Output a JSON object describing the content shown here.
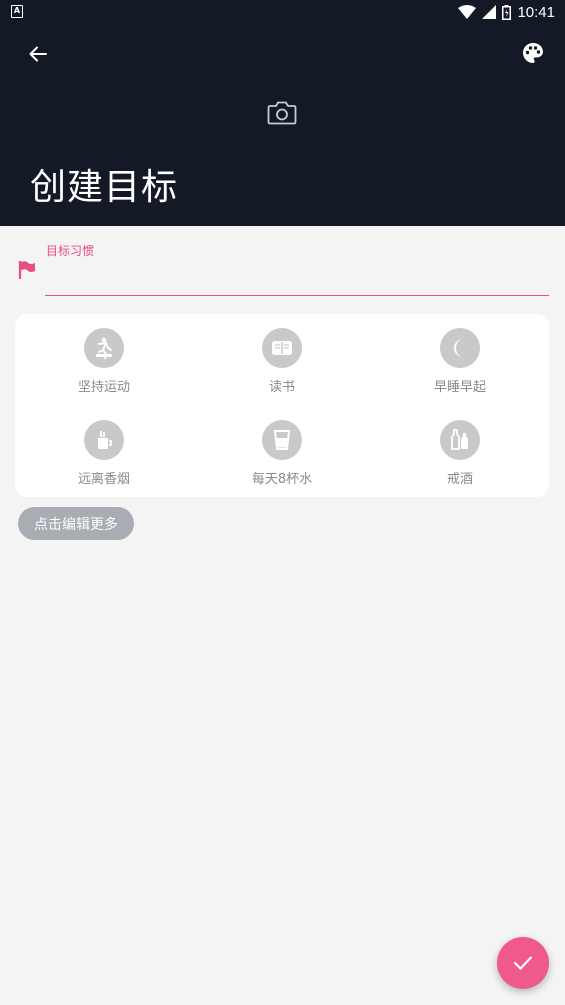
{
  "status_bar": {
    "left_icon": "A",
    "time": "10:41",
    "icons": [
      "wifi-icon",
      "signal-icon",
      "battery-icon"
    ]
  },
  "header": {
    "title": "创建目标",
    "back_icon": "arrow-left-icon",
    "palette_icon": "palette-icon",
    "camera_icon": "camera-icon",
    "background": "#131a26"
  },
  "goal_field": {
    "label": "目标习惯",
    "value": "",
    "icon": "flag-icon",
    "accent": "#ea4c86"
  },
  "habits": [
    {
      "label": "坚持运动",
      "icon": "exercise-icon"
    },
    {
      "label": "读书",
      "icon": "book-icon"
    },
    {
      "label": "早睡早起",
      "icon": "moon-icon"
    },
    {
      "label": "远离香烟",
      "icon": "no-smoking-icon"
    },
    {
      "label": "每天8杯水",
      "icon": "water-glass-icon"
    },
    {
      "label": "戒酒",
      "icon": "bottles-icon"
    }
  ],
  "more_button": {
    "label": "点击编辑更多"
  },
  "fab": {
    "icon": "check-icon",
    "color": "#ef5a8b"
  }
}
